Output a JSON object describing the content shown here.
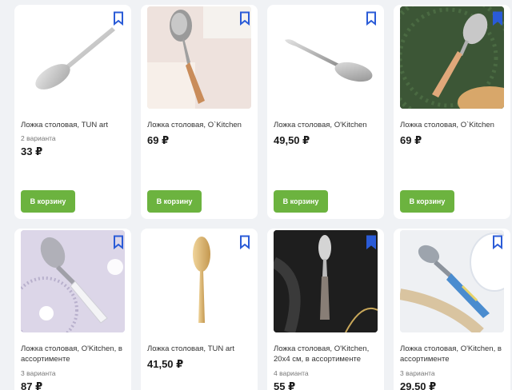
{
  "products": [
    {
      "title": "Ложка столовая, TUN art",
      "variants": "2 варианта",
      "price": "33 ₽",
      "button": "В корзину"
    },
    {
      "title": "Ложка столовая, O`Kitchen",
      "variants": "",
      "price": "69 ₽",
      "button": "В корзину"
    },
    {
      "title": "Ложка столовая, O'Kitchen",
      "variants": "",
      "price": "49,50 ₽",
      "button": "В корзину"
    },
    {
      "title": "Ложка столовая, O`Kitchen",
      "variants": "",
      "price": "69 ₽",
      "button": "В корзину"
    },
    {
      "title": "Ложка столовая, O'Kitchen, в ассортименте",
      "variants": "3 варианта",
      "price": "87 ₽"
    },
    {
      "title": "Ложка столовая, TUN art",
      "variants": "",
      "price": "41,50 ₽"
    },
    {
      "title": "Ложка столовая, O'Kitchen, 20х4 см, в ассортименте",
      "variants": "4 варианта",
      "price": "55 ₽"
    },
    {
      "title": "Ложка столовая, O'Kitchen, в ассортименте",
      "variants": "3 варианта",
      "price": "29,50 ₽"
    }
  ],
  "icons": {
    "bookmark": "bookmark-icon"
  },
  "colors": {
    "accent_green": "#6cb33f",
    "bookmark_blue": "#2a5bd7"
  }
}
